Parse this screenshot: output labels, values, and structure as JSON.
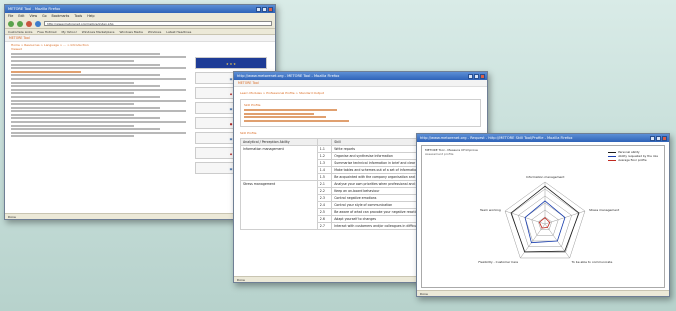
{
  "window1": {
    "title": "METORE Tool - Mozilla Firefox",
    "menu": [
      "File",
      "Edit",
      "View",
      "Go",
      "Bookmarks",
      "Tools",
      "Help"
    ],
    "url": "http://www.metorenet.org/metore/index.php",
    "bookmarks": [
      "Customize Links",
      "Free Hotmail",
      "My Yahoo!",
      "Windows Marketplace",
      "Windows Media",
      "Windows",
      "Latest Headlines"
    ],
    "site_title": "METORE Tool",
    "breadcrumb": "Home > Resources > Language > ... > Introduction",
    "heading": "Viewed",
    "status": "Done"
  },
  "window2": {
    "title": "http://www.metorenet.org - METORE Tool - Mozilla Firefox",
    "site_title": "METORE Tool",
    "breadcrumb": "Learn Modules > Professional Profile > Standard Output",
    "section_heading": "Skill Profile",
    "profile_heading": "Skill Profile",
    "table_headers": [
      "Analytical / Perception Ability",
      "Skill"
    ],
    "groups": [
      {
        "name": "Information management",
        "items": [
          {
            "code": "1.1",
            "text": "Write reports"
          },
          {
            "code": "1.2",
            "text": "Organise and synthesise information"
          },
          {
            "code": "1.3",
            "text": "Summarise technical information in brief and clear reports/presentations"
          },
          {
            "code": "1.4",
            "text": "Make tables and schemes out of a set of information"
          },
          {
            "code": "1.5",
            "text": "Be acquainted with the company organisation and services"
          }
        ]
      },
      {
        "name": "Stress management",
        "items": [
          {
            "code": "2.1",
            "text": "Analyse your own priorities when professional and personal contexts change"
          },
          {
            "code": "2.2",
            "text": "Keep an on-board behaviour"
          },
          {
            "code": "2.3",
            "text": "Control negative emotions"
          },
          {
            "code": "2.4",
            "text": "Control your style of communication"
          },
          {
            "code": "2.5",
            "text": "Be aware of what can provoke your negative reaction"
          },
          {
            "code": "2.6",
            "text": "Adapt yourself to changes"
          },
          {
            "code": "2.7",
            "text": "Interact with customers and/or colleagues in difficult situations"
          }
        ]
      }
    ],
    "status": "Done"
  },
  "window3": {
    "title": "http://www.metorenet.org - Request - http://METORE Skill Tool/Profile - Mozilla Firefox",
    "chart_heading": "METORE Tool - Measure Of Improve",
    "chart_subheading": "Assessment profile",
    "status": "Done",
    "legend": [
      {
        "name": "Personal ability",
        "color": "#1a1a1a"
      },
      {
        "name": "Ability requested by the role",
        "color": "#1a3fb0"
      },
      {
        "name": "Average floor profile",
        "color": "#c0281f"
      }
    ]
  },
  "chart_data": {
    "type": "radar",
    "axes": [
      "Information management",
      "Stress management",
      "To be able to communicate",
      "Flexibility - Customer Care",
      "Team working"
    ],
    "rings": 6,
    "series": [
      {
        "name": "Personal ability",
        "values": [
          0.9,
          0.85,
          0.8,
          0.82,
          0.85
        ]
      },
      {
        "name": "Ability requested by the role",
        "values": [
          0.55,
          0.5,
          0.5,
          0.55,
          0.5
        ]
      },
      {
        "name": "Average floor profile",
        "values": [
          0.15,
          0.12,
          0.1,
          0.12,
          0.14
        ]
      }
    ]
  },
  "colors": {
    "accent": "#d9681e",
    "title_bar": "#2f63b8"
  }
}
